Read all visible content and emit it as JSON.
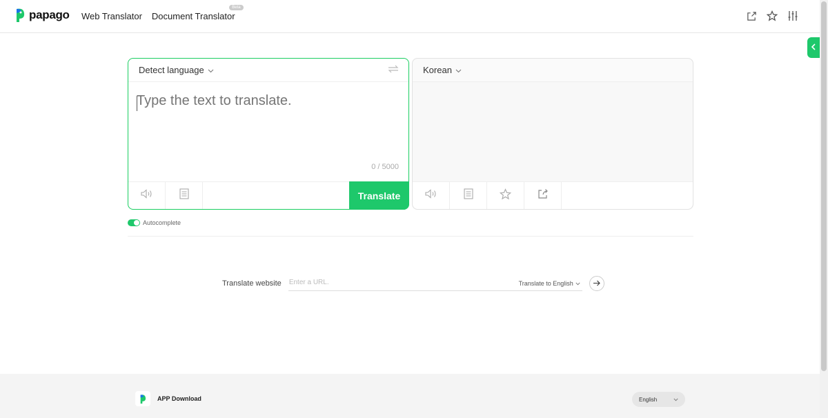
{
  "header": {
    "logo_text": "papago",
    "nav": [
      {
        "label": "Web Translator"
      },
      {
        "label": "Document Translator",
        "badge": "Beta"
      }
    ],
    "icons": [
      "share-icon",
      "star-icon",
      "settings-sliders-icon"
    ]
  },
  "source": {
    "language": "Detect language",
    "placeholder": "Type the text to translate.",
    "counter": "0 / 5000",
    "translate_label": "Translate"
  },
  "target": {
    "language": "Korean"
  },
  "autocomplete": {
    "label": "Autocomplete",
    "enabled": true
  },
  "web": {
    "label": "Translate website",
    "placeholder": "Enter a URL.",
    "target": "Translate to English"
  },
  "footer": {
    "app_download": "APP Download",
    "language": "English"
  },
  "colors": {
    "accent": "#1ec86b"
  }
}
